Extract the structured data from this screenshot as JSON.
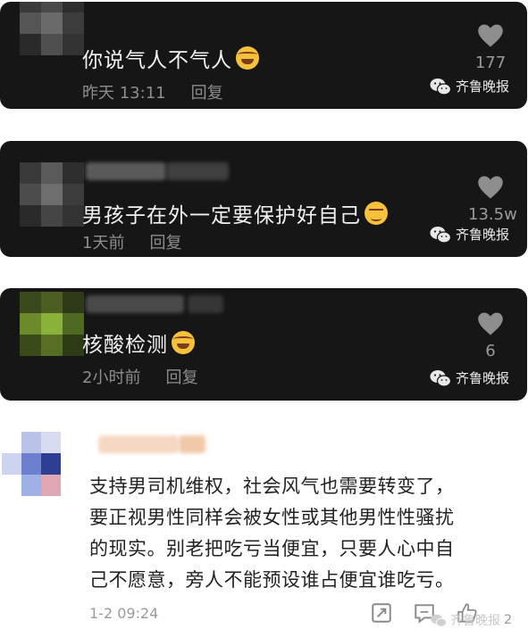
{
  "watermark": "齐鲁晚报",
  "comments": [
    {
      "text": "你说气人不气人",
      "emoji": "laughing-face",
      "time": "昨天 13:11",
      "reply": "回复",
      "likes": "177"
    },
    {
      "text": "男孩子在外一定要保护好自己",
      "emoji": "smirking-face",
      "time": "1天前",
      "reply": "回复",
      "likes": "13.5w"
    },
    {
      "text": "核酸检测",
      "emoji": "laughing-face",
      "time": "2小时前",
      "reply": "回复",
      "likes": "6"
    }
  ],
  "highlight_comment": {
    "lines": [
      "支持男司机维权，社会风气也需要转变了，",
      "要正视男性同样会被女性或其他男性性骚扰",
      "的现实。别老把吃亏当便宜，只要人心中自",
      "己不愿意，旁人不能预设谁占便宜谁吃亏。"
    ],
    "time": "1-2 09:24",
    "likes": "2"
  },
  "colors": {
    "card_bg": "#161616",
    "text": "#f2f2f2",
    "meta": "#8d8d8d",
    "emoji": "#f7c13b"
  }
}
